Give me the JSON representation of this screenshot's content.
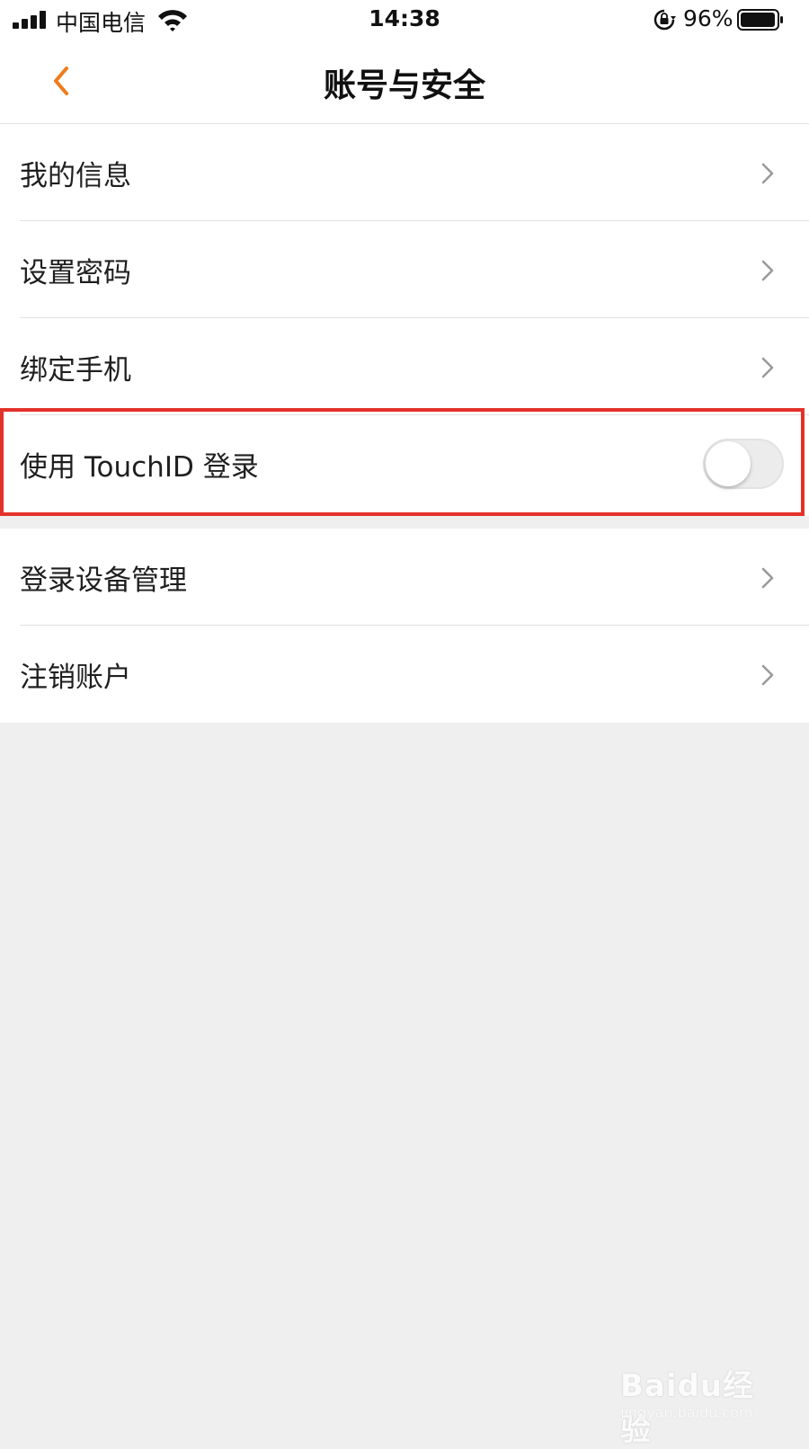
{
  "status_bar": {
    "carrier": "中国电信",
    "time": "14:38",
    "battery_percent": "96%",
    "battery_level": 0.96,
    "icons": [
      "signal-icon",
      "wifi-icon",
      "orientation-lock-icon",
      "battery-icon"
    ]
  },
  "nav": {
    "title": "账号与安全",
    "back_icon": "chevron-left-icon",
    "accent_color": "#f07a1a"
  },
  "settings": {
    "items": [
      {
        "label": "我的信息",
        "type": "link"
      },
      {
        "label": "设置密码",
        "type": "link"
      },
      {
        "label": "绑定手机",
        "type": "link"
      },
      {
        "label": "使用 TouchID 登录",
        "type": "toggle",
        "enabled": false
      },
      {
        "label": "登录设备管理",
        "type": "link"
      },
      {
        "label": "注销账户",
        "type": "link"
      }
    ]
  },
  "watermark": {
    "brand": "Baidu经验",
    "url": "jingyan.baidu.com"
  },
  "colors": {
    "highlight": "#e3322b",
    "background": "#efefef"
  }
}
